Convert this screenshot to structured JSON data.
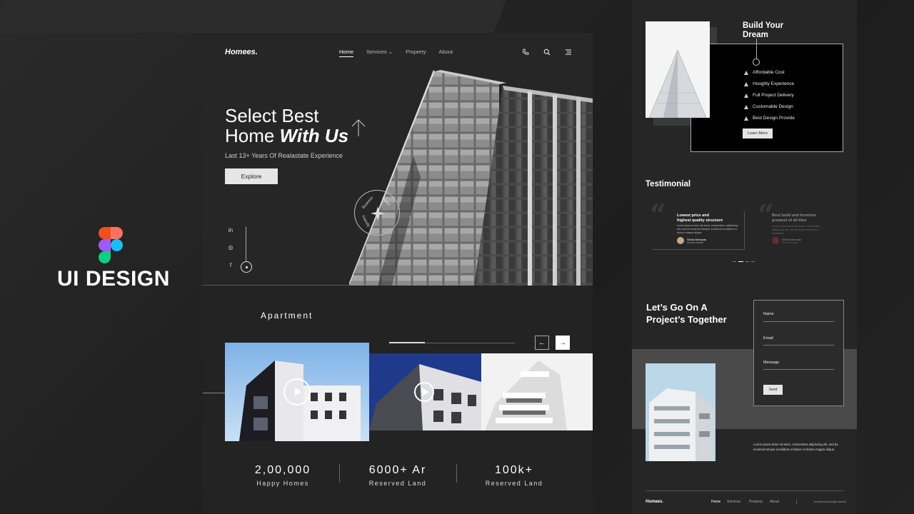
{
  "brand": {
    "title": "UI DESIGN"
  },
  "header": {
    "logo": "Homees.",
    "nav": [
      "Home",
      "Services",
      "Property",
      "About"
    ]
  },
  "hero": {
    "title_line1": "Select Best",
    "title_line2_a": "Home ",
    "title_line2_b": "With Us",
    "subtitle": "Last 13+ Years Of Realastate Experience",
    "cta": "Explore",
    "badge_words": [
      "Business",
      "Expert",
      "Friendly"
    ]
  },
  "social": [
    "in",
    "◎",
    "f"
  ],
  "apartment": {
    "title": "Apartment",
    "prev": "←",
    "next": "→"
  },
  "stats": [
    {
      "value": "2,00,000",
      "label": "Happy Homes"
    },
    {
      "value": "6000+ Ar",
      "label": "Reserved Land"
    },
    {
      "value": "100k+",
      "label": "Reserved Land"
    }
  ],
  "build": {
    "title_line1": "Build Your",
    "title_line2": "Dream",
    "features": [
      "Affordable Cost",
      "Hooghly Experience",
      "Full Project Delivery",
      "Customable Design",
      "Best Design Provide"
    ],
    "cta": "Learn More"
  },
  "testimonial": {
    "title": "Testimonial",
    "cards": [
      {
        "heading1": "Lowest price and",
        "heading2": "highest quality structure",
        "body": "Lorem ipsum dolor sit amet, consectetur adipiscing elit, sed do eiusmod tempor incididunt ut labore et dolore magna aliqua.",
        "name": "Shola Mervada",
        "role": "Service Holder"
      },
      {
        "heading1": "Best build and furniture",
        "heading2": "greatest of all time",
        "body": "Lorem ipsum dolor sit amet, consectetur adipiscing elit, sed do eiusmod tempor incididunt.",
        "name": "Shola Mervada",
        "role": "Service Holder"
      }
    ]
  },
  "contact": {
    "title_line1": "Let’s Go On A",
    "title_line2": "Project’s Together",
    "fields": [
      "Name",
      "Email",
      "Message"
    ],
    "send": "Send",
    "description": "Lorem ipsum dolor sit amet, consectetur adipiscing elit, sed do eiusmod tempor incididunt ut labore et dolore magna aliqua."
  },
  "footer": {
    "logo": "Homees.",
    "nav": [
      "Home",
      "Services",
      "Property",
      "About"
    ],
    "copyright": "homees.com/all right reserve"
  },
  "colors": {
    "background": "#232323",
    "panel": "#262626",
    "accent": "#ffffff",
    "button": "#e6e6e6"
  }
}
